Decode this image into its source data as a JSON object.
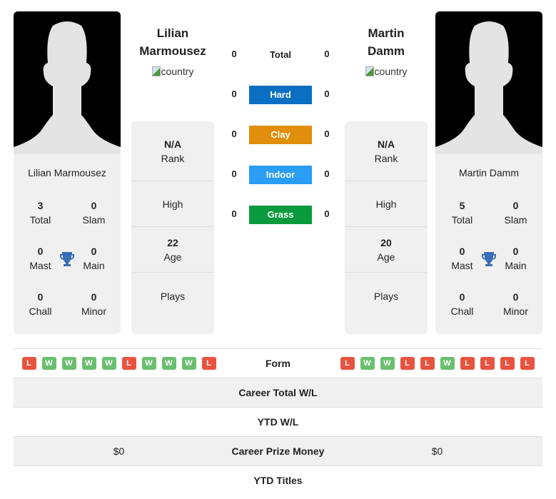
{
  "player1": {
    "name": "Lilian Marmousez",
    "title_line1": "Lilian",
    "title_line2": "Marmousez",
    "country_alt": "country",
    "titles": {
      "total": "3",
      "slam": "0",
      "mast": "0",
      "main": "0",
      "chall": "0",
      "minor": "0"
    },
    "rank": "N/A",
    "high": "",
    "age": "22",
    "plays": ""
  },
  "player2": {
    "name": "Martin Damm",
    "title_line1": "Martin",
    "title_line2": "Damm",
    "country_alt": "country",
    "titles": {
      "total": "5",
      "slam": "0",
      "mast": "0",
      "main": "0",
      "chall": "0",
      "minor": "0"
    },
    "rank": "N/A",
    "high": "",
    "age": "20",
    "plays": ""
  },
  "labels": {
    "total": "Total",
    "slam": "Slam",
    "mast": "Mast",
    "main": "Main",
    "chall": "Chall",
    "minor": "Minor",
    "rank": "Rank",
    "high": "High",
    "age": "Age",
    "plays": "Plays"
  },
  "surfaces": [
    {
      "name": "Total",
      "p1": "0",
      "p2": "0",
      "color": ""
    },
    {
      "name": "Hard",
      "p1": "0",
      "p2": "0",
      "color": "#0a6fc2"
    },
    {
      "name": "Clay",
      "p1": "0",
      "p2": "0",
      "color": "#e08e0b"
    },
    {
      "name": "Indoor",
      "p1": "0",
      "p2": "0",
      "color": "#2a9df4"
    },
    {
      "name": "Grass",
      "p1": "0",
      "p2": "0",
      "color": "#0a9a3e"
    }
  ],
  "form": {
    "label": "Form",
    "p1": [
      "L",
      "W",
      "W",
      "W",
      "W",
      "L",
      "W",
      "W",
      "W",
      "L"
    ],
    "p2": [
      "L",
      "W",
      "W",
      "L",
      "L",
      "W",
      "L",
      "L",
      "L",
      "L"
    ]
  },
  "stats": [
    {
      "label": "Career Total W/L",
      "p1": "",
      "p2": ""
    },
    {
      "label": "YTD W/L",
      "p1": "",
      "p2": ""
    },
    {
      "label": "Career Prize Money",
      "p1": "$0",
      "p2": "$0"
    },
    {
      "label": "YTD Titles",
      "p1": "",
      "p2": ""
    }
  ]
}
